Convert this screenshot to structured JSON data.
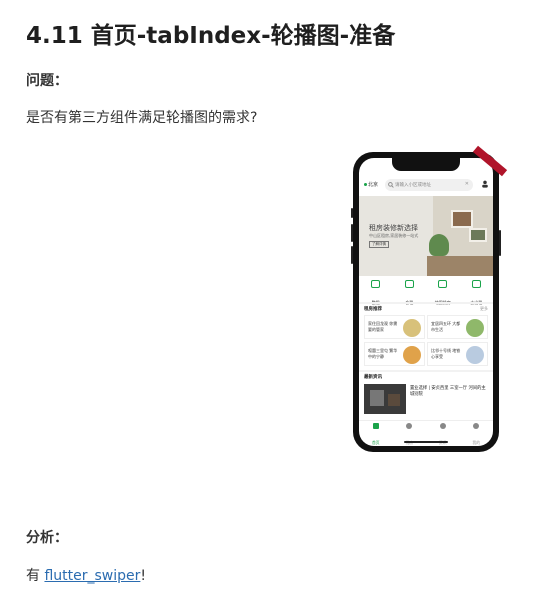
{
  "doc": {
    "title": "4.11 首页-tabIndex-轮播图-准备",
    "question_label": "问题：",
    "question_text": "是否有第三方组件满足轮播图的需求?",
    "analysis_label": "分析：",
    "analysis_prefix": "有 ",
    "analysis_link": "flutter_swiper",
    "analysis_suffix": "!"
  },
  "phone": {
    "location": "北京",
    "search_placeholder": "请输入小区或地址",
    "banner": {
      "title": "租房装修新选择",
      "subtitle": "中山区租房,家居装修一站式",
      "button": "了解详情"
    },
    "grid": [
      {
        "label": "整租",
        "icon": "house-icon"
      },
      {
        "label": "合租",
        "icon": "people-icon"
      },
      {
        "label": "地图找房",
        "icon": "map-icon"
      },
      {
        "label": "去出租",
        "icon": "key-icon"
      }
    ],
    "recommend_title": "租房推荐",
    "recommend_more": "更多",
    "cards": [
      {
        "text": "家住回龙观 你需要的管家",
        "pic_color": "#d8c17a"
      },
      {
        "text": "宜居四五环 大都市生活",
        "pic_color": "#8fb86a"
      },
      {
        "text": "喧嚣三里屯 繁华中的宁静",
        "pic_color": "#e0a24a"
      },
      {
        "text": "比邻十号线 地铁心享受",
        "pic_color": "#b9cbe0"
      }
    ],
    "news_title": "最新资讯",
    "news_text": "置业选择 | 安贞西里 三室一厅 河间的主城别院",
    "tabs": [
      {
        "label": "首页",
        "active": true
      },
      {
        "label": "找房",
        "active": false
      },
      {
        "label": "资讯",
        "active": false
      },
      {
        "label": "我的",
        "active": false
      }
    ],
    "accent_color": "#1aa34a"
  }
}
